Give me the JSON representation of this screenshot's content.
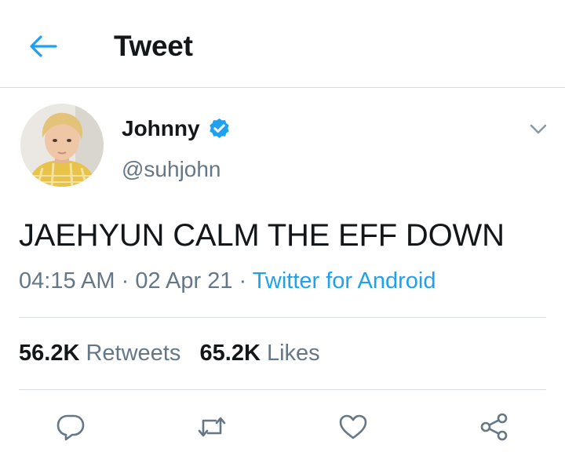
{
  "header": {
    "title": "Tweet",
    "back_icon": "back-arrow-icon"
  },
  "tweet": {
    "author_name": "Johnny",
    "handle": "@suhjohn",
    "verified": true,
    "text": "JAEHYUN CALM THE EFF DOWN",
    "time": "04:15 AM",
    "date": "02 Apr 21",
    "separator": "·",
    "source": "Twitter for Android",
    "retweets_count": "56.2K",
    "retweets_label": "Retweets",
    "likes_count": "65.2K",
    "likes_label": "Likes"
  },
  "actions": [
    "reply-icon",
    "retweet-icon",
    "like-icon",
    "share-icon"
  ],
  "colors": {
    "accent": "#1da1f2",
    "text": "#14171a",
    "secondary": "#657786",
    "divider": "#d7dde2"
  }
}
